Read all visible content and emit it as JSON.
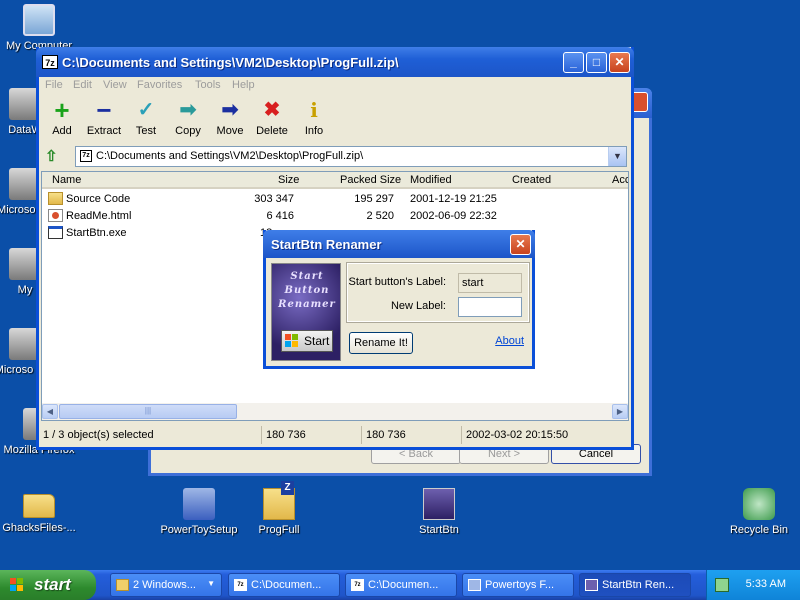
{
  "desktop": {
    "icons": {
      "my_computer": "My Computer",
      "datawin_partial": "DataW",
      "microsoft_partial": "Microso C+",
      "my_partial": "My",
      "microsoft_bas_partial": "Microso Bas",
      "firefox_partial": "Mozilla Firefox",
      "ghacks": "GhacksFiles-...",
      "powertoysetup": "PowerToySetup",
      "progfull": "ProgFull",
      "startbtn": "StartBtn",
      "recycle_bin": "Recycle Bin"
    }
  },
  "back_window": {
    "buttons": {
      "back": "< Back",
      "next": "Next >",
      "cancel": "Cancel"
    }
  },
  "main_window": {
    "title": "C:\\Documents and Settings\\VM2\\Desktop\\ProgFull.zip\\",
    "app_icon": "7z",
    "menu": [
      "File",
      "Edit",
      "View",
      "Favorites",
      "Tools",
      "Help"
    ],
    "toolbar": [
      {
        "label": "Add",
        "icon": "plus-icon"
      },
      {
        "label": "Extract",
        "icon": "minus-icon"
      },
      {
        "label": "Test",
        "icon": "check-icon"
      },
      {
        "label": "Copy",
        "icon": "copy-arrow-icon"
      },
      {
        "label": "Move",
        "icon": "move-arrow-icon"
      },
      {
        "label": "Delete",
        "icon": "delete-x-icon"
      },
      {
        "label": "Info",
        "icon": "info-icon"
      }
    ],
    "address": "C:\\Documents and Settings\\VM2\\Desktop\\ProgFull.zip\\",
    "columns": [
      "Name",
      "Size",
      "Packed Size",
      "Modified",
      "Created",
      "Acce"
    ],
    "files": [
      {
        "name": "Source Code",
        "size": "303 347",
        "packed": "195 297",
        "modified": "2001-12-19 21:25",
        "type": "folder"
      },
      {
        "name": "ReadMe.html",
        "size": "6 416",
        "packed": "2 520",
        "modified": "2002-06-09 22:32",
        "type": "html"
      },
      {
        "name": "StartBtn.exe",
        "size": "18",
        "packed": "",
        "modified": "",
        "type": "exe"
      }
    ],
    "status": {
      "selected": "1 / 3 object(s) selected",
      "size": "180 736",
      "packed": "180 736",
      "modified": "2002-03-02 20:15:50"
    }
  },
  "dialog": {
    "title": "StartBtn Renamer",
    "logo_text": "Start Button Renamer",
    "logo_start": "Start",
    "current_label_caption": "Start button's Label:",
    "current_label_value": "start",
    "new_label_caption": "New Label:",
    "new_label_value": "",
    "rename_button": "Rename It!",
    "about_link": "About"
  },
  "taskbar": {
    "start": "start",
    "tasks": [
      {
        "label": "2 Windows...",
        "icon": "folder"
      },
      {
        "label": "C:\\Documen...",
        "icon": "7z"
      },
      {
        "label": "C:\\Documen...",
        "icon": "7z"
      },
      {
        "label": "Powertoys F...",
        "icon": "app"
      },
      {
        "label": "StartBtn Ren...",
        "icon": "app"
      }
    ],
    "clock": "5:33 AM"
  }
}
